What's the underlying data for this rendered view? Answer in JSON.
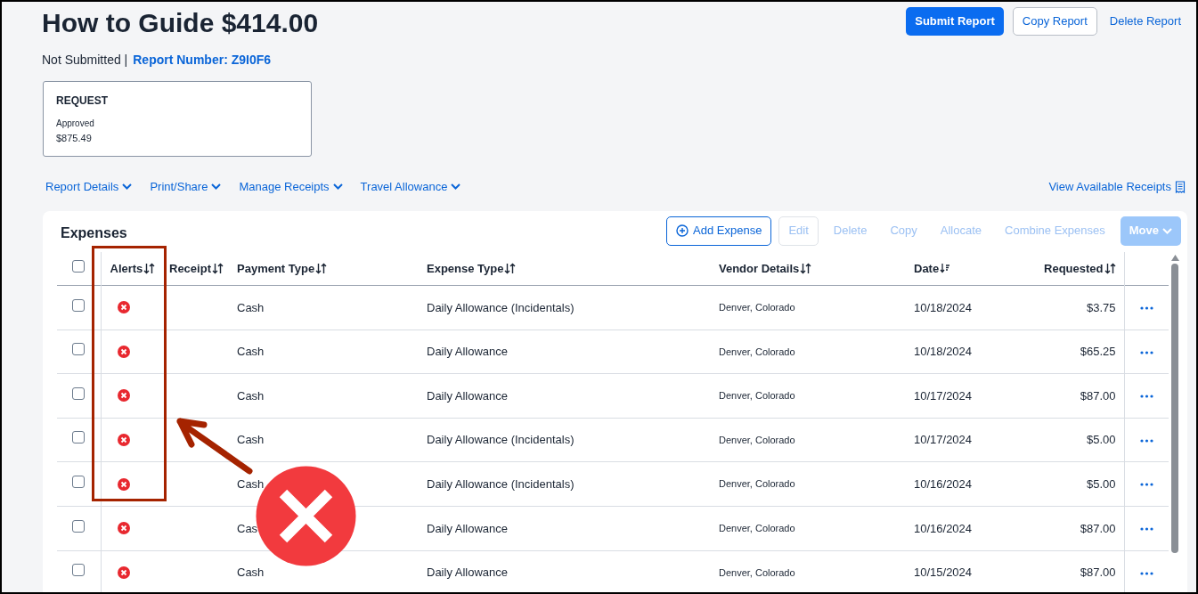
{
  "header": {
    "title": "How to Guide $414.00",
    "status": "Not Submitted |",
    "report_number": "Report Number: Z9I0F6",
    "actions": [
      {
        "label": "Submit Report",
        "kind": "primary"
      },
      {
        "label": "Copy Report",
        "kind": "outline"
      },
      {
        "label": "Delete Report",
        "kind": "link"
      }
    ]
  },
  "request_card": {
    "title": "REQUEST",
    "status": "Approved",
    "amount": "$875.49"
  },
  "menus": [
    "Report Details",
    "Print/Share",
    "Manage Receipts",
    "Travel Allowance"
  ],
  "receipts_link": "View Available Receipts",
  "expenses": {
    "title": "Expenses",
    "toolbar": [
      {
        "label": "Add Expense",
        "kind": "add",
        "disabled": false
      },
      {
        "label": "Edit",
        "kind": "outline",
        "disabled": true
      },
      {
        "label": "Delete",
        "kind": "text",
        "disabled": true
      },
      {
        "label": "Copy",
        "kind": "text",
        "disabled": true
      },
      {
        "label": "Allocate",
        "kind": "text",
        "disabled": true
      },
      {
        "label": "Combine Expenses",
        "kind": "text",
        "disabled": true
      },
      {
        "label": "Move",
        "kind": "menu",
        "disabled": true
      }
    ],
    "select_all": {
      "checked": false
    },
    "columns": [
      {
        "label": "Alerts",
        "sorted": false
      },
      {
        "label": "Receipt",
        "sorted": false
      },
      {
        "label": "Payment Type",
        "sorted": false
      },
      {
        "label": "Expense Type",
        "sorted": false
      },
      {
        "label": "Vendor Details",
        "sorted": false
      },
      {
        "label": "Date",
        "sorted": true
      },
      {
        "label": "Requested",
        "sorted": false
      }
    ],
    "rows": [
      {
        "checked": false,
        "alert": true,
        "payment_type": "Cash",
        "expense_type": "Daily Allowance (Incidentals)",
        "vendor": "Denver, Colorado",
        "date": "10/18/2024",
        "requested": "$3.75"
      },
      {
        "checked": false,
        "alert": true,
        "payment_type": "Cash",
        "expense_type": "Daily Allowance",
        "vendor": "Denver, Colorado",
        "date": "10/18/2024",
        "requested": "$65.25"
      },
      {
        "checked": false,
        "alert": true,
        "payment_type": "Cash",
        "expense_type": "Daily Allowance",
        "vendor": "Denver, Colorado",
        "date": "10/17/2024",
        "requested": "$87.00"
      },
      {
        "checked": false,
        "alert": true,
        "payment_type": "Cash",
        "expense_type": "Daily Allowance (Incidentals)",
        "vendor": "Denver, Colorado",
        "date": "10/17/2024",
        "requested": "$5.00"
      },
      {
        "checked": false,
        "alert": true,
        "payment_type": "Cash",
        "expense_type": "Daily Allowance (Incidentals)",
        "vendor": "Denver, Colorado",
        "date": "10/16/2024",
        "requested": "$5.00"
      },
      {
        "checked": false,
        "alert": true,
        "payment_type": "Cas",
        "expense_type": "Daily Allowance",
        "vendor": "Denver, Colorado",
        "date": "10/16/2024",
        "requested": "$87.00"
      },
      {
        "checked": false,
        "alert": true,
        "payment_type": "Cash",
        "expense_type": "Daily Allowance",
        "vendor": "Denver, Colorado",
        "date": "10/15/2024",
        "requested": "$87.00"
      }
    ]
  }
}
